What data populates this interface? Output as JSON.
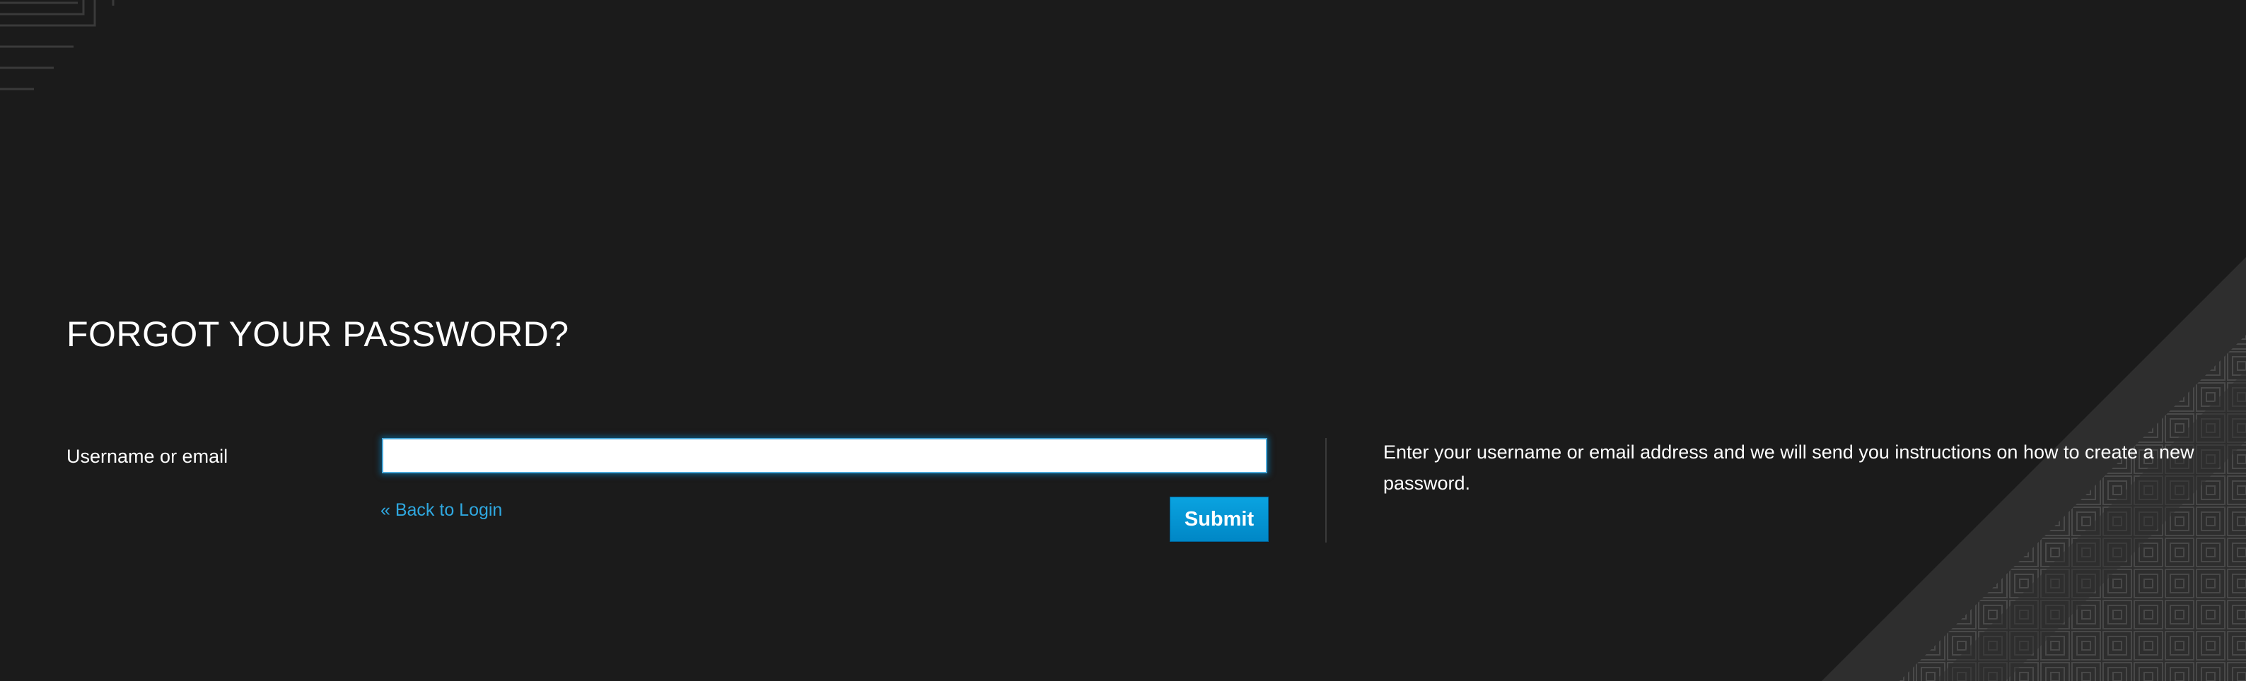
{
  "page": {
    "title": "FORGOT YOUR PASSWORD?"
  },
  "form": {
    "username_label": "Username or email",
    "username_value": "",
    "back_link_label": "« Back to Login",
    "submit_label": "Submit"
  },
  "info": {
    "text": "Enter your username or email address and we will send you instructions on how to create a new password."
  },
  "colors": {
    "background": "#1b1b1b",
    "accent": "#0088ce",
    "link": "#2fa8e0",
    "decoration": "#3a3a3a"
  }
}
